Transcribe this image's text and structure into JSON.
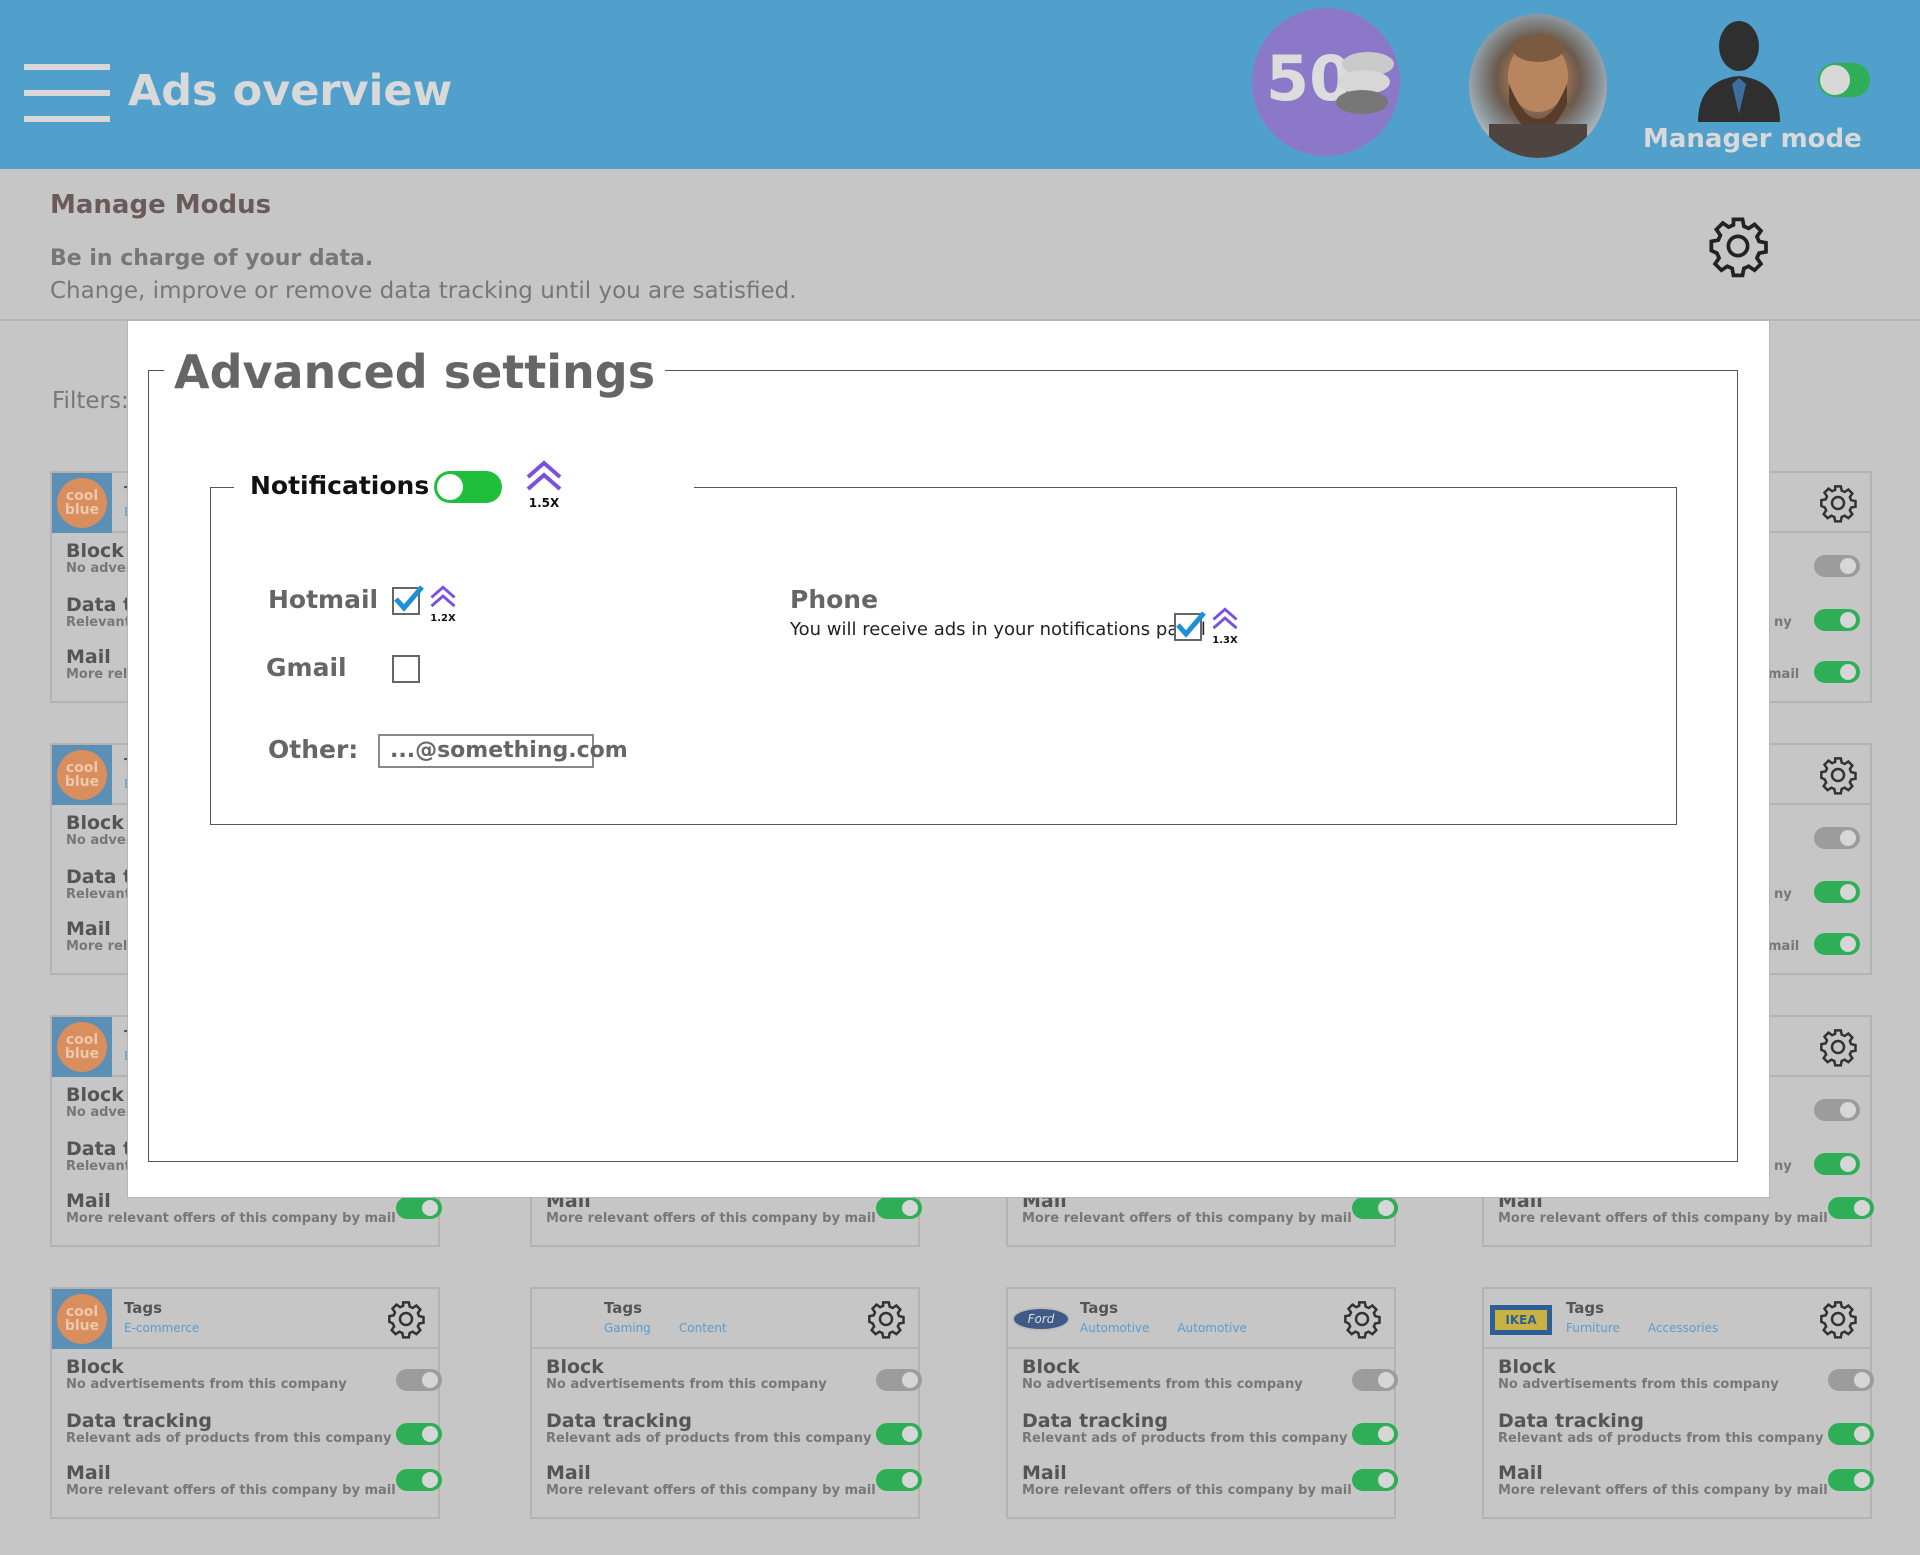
{
  "header": {
    "title": "Ads overview",
    "points": "50",
    "manager_label": "Manager mode",
    "menu_icon": "hamburger-menu-icon",
    "coins_icon": "coin-stack-icon",
    "manager_icon": "manager-person-icon"
  },
  "subheader": {
    "title": "Manage Modus",
    "lead": "Be in charge of your data.",
    "description": "Change, improve or remove data tracking until you are satisfied.",
    "filters_label": "Filters:"
  },
  "card_rows": {
    "block_title": "Block",
    "block_sub": "No advertisements from this company",
    "tracking_title": "Data tracking",
    "tracking_sub": "Relevant ads of products from this company",
    "mail_title": "Mail",
    "mail_sub": "More relevant offers of this company by mail"
  },
  "partial_cards": {
    "left_title_fragment": "T",
    "left_tag_fragment": "E",
    "left_block": "Block",
    "left_block_sub": "No adver",
    "left_tracking": "Data tr",
    "left_tracking_sub": "Relevant",
    "left_mail": "Mail",
    "left_mail_sub": "More rele",
    "right_tracking_fragment": "ny",
    "right_mail_fragment": "mail"
  },
  "cards": [
    {
      "logo": "coolblue",
      "logo_text": "cool blue",
      "tags_title": "Tags",
      "tags": [
        "E-commerce"
      ]
    },
    {
      "logo": "none",
      "logo_text": "",
      "tags_title": "Tags",
      "tags": [
        "Gaming",
        "Content"
      ]
    },
    {
      "logo": "ford",
      "logo_text": "Ford",
      "tags_title": "Tags",
      "tags": [
        "Automotive",
        "Automotive"
      ]
    },
    {
      "logo": "ikea",
      "logo_text": "IKEA",
      "tags_title": "Tags",
      "tags": [
        "Furniture",
        "Accessories"
      ]
    }
  ],
  "modal": {
    "title": "Advanced settings",
    "notifications_label": "Notifications",
    "notifications_enabled": true,
    "notifications_boost": "1.5X",
    "hotmail_label": "Hotmail",
    "hotmail_checked": true,
    "hotmail_boost": "1.2X",
    "gmail_label": "Gmail",
    "gmail_checked": false,
    "other_label": "Other:",
    "other_value": "...@something.com",
    "phone_label": "Phone",
    "phone_desc": "You will receive ads in your notifications panel",
    "phone_checked": true,
    "phone_boost": "1.3X"
  },
  "colors": {
    "header_bg": "#51a0cb",
    "accent_purple": "#7b4fe0",
    "toggle_green": "#1fbf3b",
    "check_blue": "#1d8fd6"
  }
}
